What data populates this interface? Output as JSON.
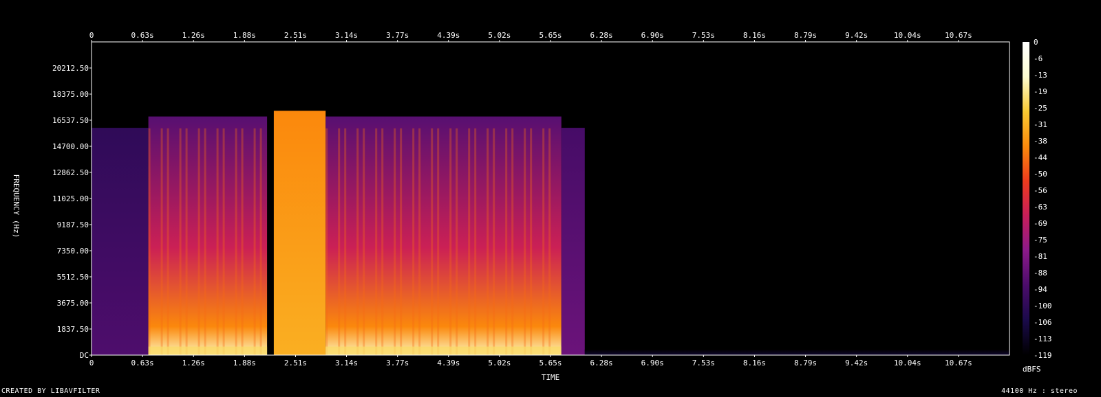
{
  "chart_data": {
    "type": "heatmap",
    "subtype": "spectrogram",
    "xlabel": "TIME",
    "ylabel": "FREQUENCY (Hz)",
    "x_unit": "s",
    "x_ticks": [
      "0",
      "0.63s",
      "1.26s",
      "1.88s",
      "2.51s",
      "3.14s",
      "3.77s",
      "4.39s",
      "5.02s",
      "5.65s",
      "6.28s",
      "6.90s",
      "7.53s",
      "8.16s",
      "8.79s",
      "9.42s",
      "10.04s",
      "10.67s"
    ],
    "xlim": [
      0,
      10.98
    ],
    "y_ticks": [
      "DC",
      "1837.50",
      "3675.00",
      "5512.50",
      "7350.00",
      "9187.50",
      "11025.00",
      "12862.50",
      "14700.00",
      "16537.50",
      "18375.00",
      "20212.50"
    ],
    "ylim": [
      0,
      22050
    ],
    "colorbar": {
      "label": "dBFS",
      "ticks": [
        "0",
        "-6",
        "-13",
        "-19",
        "-25",
        "-31",
        "-38",
        "-44",
        "-50",
        "-56",
        "-63",
        "-69",
        "-75",
        "-81",
        "-88",
        "-94",
        "-100",
        "-106",
        "-113",
        "-119"
      ],
      "range": [
        -119,
        0
      ],
      "colors": [
        "#000000",
        "#1a0a4a",
        "#4b0c6b",
        "#8b1a8a",
        "#c81e5a",
        "#ee3b1d",
        "#fb8a0c",
        "#f9c932",
        "#fcfcd0",
        "#ffffff"
      ]
    },
    "segments": [
      {
        "start": 0.0,
        "end": 0.68,
        "level_db": -100,
        "bandwidth_hz": 16000,
        "kind": "noise"
      },
      {
        "start": 0.68,
        "end": 2.1,
        "level_db": -50,
        "bandwidth_hz": 16800,
        "kind": "speech"
      },
      {
        "start": 2.18,
        "end": 2.8,
        "level_db": -40,
        "bandwidth_hz": 17200,
        "kind": "broadband-noise"
      },
      {
        "start": 2.8,
        "end": 5.62,
        "level_db": -50,
        "bandwidth_hz": 16800,
        "kind": "speech"
      },
      {
        "start": 5.62,
        "end": 5.9,
        "level_db": -94,
        "bandwidth_hz": 16000,
        "kind": "noise"
      },
      {
        "start": 5.9,
        "end": 10.98,
        "level_db": -119,
        "bandwidth_hz": 400,
        "kind": "silence"
      }
    ]
  },
  "footer": {
    "credit": "CREATED BY LIBAVFILTER",
    "info": "44100 Hz : stereo"
  }
}
